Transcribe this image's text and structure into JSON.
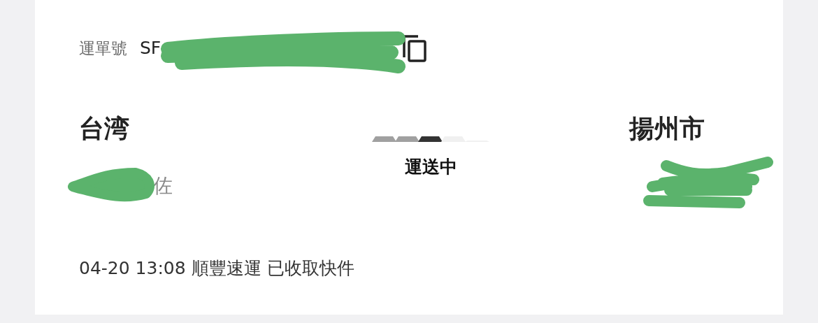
{
  "waybill": {
    "label": "運單號",
    "number": "SF"
  },
  "origin": {
    "city": "台湾",
    "name": "佐"
  },
  "destination": {
    "city": "揚州市"
  },
  "status": {
    "text": "運送中",
    "steps": [
      {
        "reached": true,
        "current": false
      },
      {
        "reached": true,
        "current": false
      },
      {
        "reached": true,
        "current": true
      },
      {
        "reached": false,
        "current": false
      },
      {
        "reached": false,
        "current": false
      }
    ]
  },
  "latest_event": "04-20 13:08 順豐速運 已收取快件"
}
